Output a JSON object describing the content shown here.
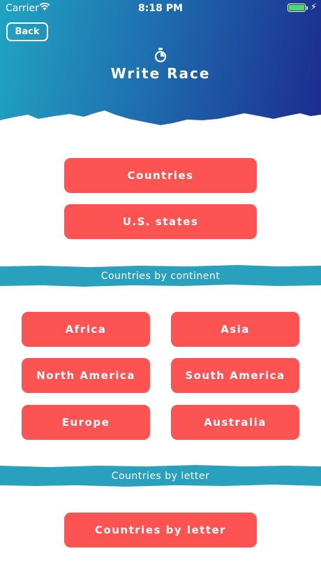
{
  "status_bar": {
    "carrier": "Carrier",
    "time": "8:18 PM",
    "battery_level": 1.0
  },
  "header": {
    "back_label": "Back",
    "title": "Write Race",
    "icon": "stopwatch-icon"
  },
  "main_buttons": {
    "countries": "Countries",
    "us_states": "U.S. states"
  },
  "continent_section": {
    "heading": "Countries by continent",
    "continents": [
      "Africa",
      "Asia",
      "North America",
      "South America",
      "Europe",
      "Australia"
    ]
  },
  "letter_section": {
    "heading": "Countries by letter",
    "button_label": "Countries by letter"
  },
  "colors": {
    "accent": "#fd5353",
    "band": "#2aa0bf",
    "header_start": "#20a4c2",
    "header_end": "#1c2b8e"
  }
}
